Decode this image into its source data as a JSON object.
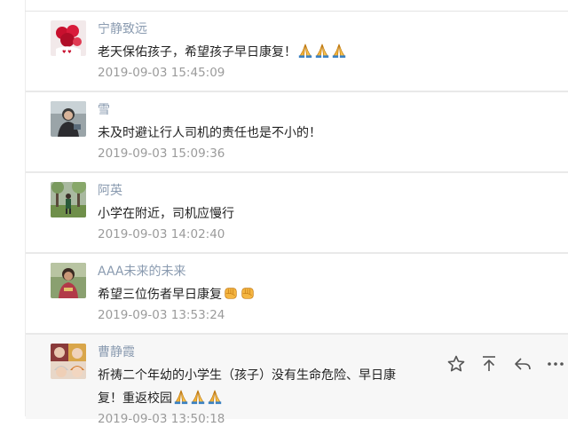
{
  "comments": [
    {
      "name": "宁静致远",
      "text": "老天保佑孩子，希望孩子早日康复！",
      "emoji": "pray",
      "emoji_count": 3,
      "time": "2019-09-03 15:45:09",
      "avatar_icon": "roses-avatar-icon"
    },
    {
      "name": "雪",
      "text": "未及时避让行人司机的责任也是不小的！",
      "emoji": "none",
      "emoji_count": 0,
      "time": "2019-09-03 15:09:36",
      "avatar_icon": "person-photo-avatar-icon"
    },
    {
      "name": "阿英",
      "text": "小学在附近，司机应慢行",
      "emoji": "none",
      "emoji_count": 0,
      "time": "2019-09-03 14:02:40",
      "avatar_icon": "trees-walker-avatar-icon"
    },
    {
      "name": "AAA未来的未来",
      "text": "希望三位伤者早日康复",
      "emoji": "fist",
      "emoji_count": 2,
      "time": "2019-09-03 13:53:24",
      "avatar_icon": "woman-outdoor-avatar-icon"
    },
    {
      "name": "曹静霞",
      "text": "祈祷二个年幼的小学生（孩子）没有生命危险、早日康复！重返校园",
      "emoji": "pray",
      "emoji_count": 3,
      "time": "2019-09-03 13:50:18",
      "avatar_icon": "baby-hats-avatar-icon"
    }
  ],
  "hover_actions": [
    {
      "icon": "star-icon",
      "label": "star"
    },
    {
      "icon": "pin-to-top-icon",
      "label": "top"
    },
    {
      "icon": "reply-icon",
      "label": "reply"
    },
    {
      "icon": "more-icon",
      "label": "more"
    }
  ],
  "colors": {
    "name": "#8a9bb0",
    "text": "#222222",
    "time": "#9b9b9b",
    "hover_bg": "#f7f7f7",
    "divider": "#e9e9e9"
  }
}
